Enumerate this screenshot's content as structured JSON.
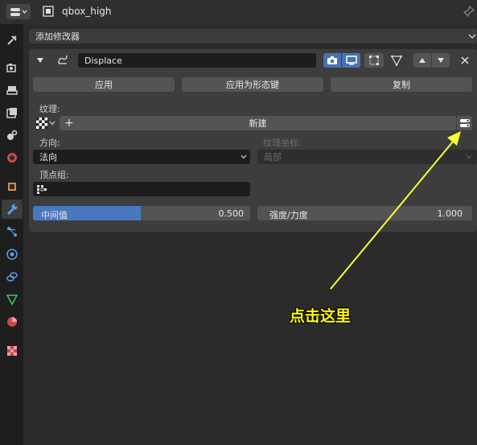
{
  "header": {
    "object_name": "qbox_high"
  },
  "add_modifier": {
    "label": "添加修改器"
  },
  "modifier": {
    "name": "Displace",
    "buttons": {
      "apply": "应用",
      "apply_as_shapekey": "应用为形态键",
      "copy": "复制"
    },
    "texture_label": "纹理:",
    "new_button": "新建",
    "direction_label": "方向:",
    "direction_value": "法向",
    "texture_coords_label": "纹理坐标:",
    "texture_coords_value": "局部",
    "vertex_group_label": "顶点组:",
    "midlevel": {
      "label": "中间值",
      "value": "0.500",
      "fill_fraction": 0.5
    },
    "strength": {
      "label": "强度/力度",
      "value": "1.000"
    }
  },
  "annotation": {
    "text": "点击这里",
    "color": "#ffff00"
  },
  "colors": {
    "accent_blue": "#4772b3",
    "slider_blue": "#4a78c0",
    "panel_bg": "#333333",
    "annotation_arrow": "#ffff33"
  },
  "sidebar_icons": [
    "tool-icon",
    "render-icon",
    "output-icon",
    "view-layer-icon",
    "scene-icon",
    "world-icon",
    "object-icon",
    "modifier-wrench-icon",
    "particles-icon",
    "physics-icon",
    "constraints-icon",
    "data-icon",
    "material-icon",
    "texture-icon"
  ]
}
